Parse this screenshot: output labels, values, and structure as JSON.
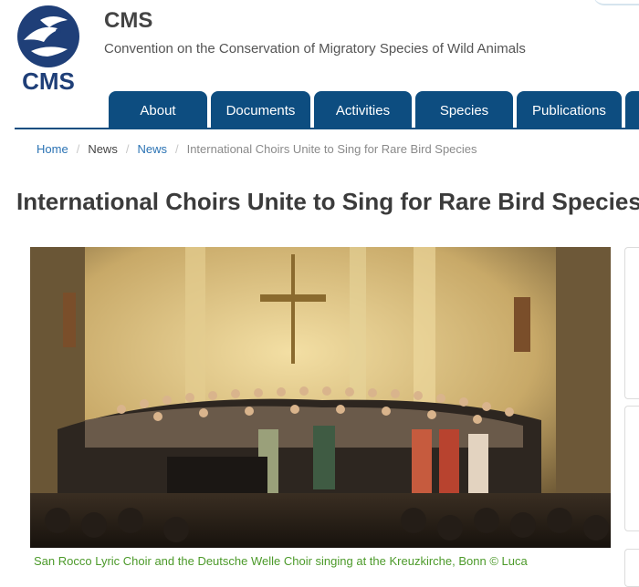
{
  "header": {
    "site_name": "CMS",
    "tagline": "Convention on the Conservation of Migratory Species of Wild Animals",
    "logo_text": "CMS"
  },
  "nav": {
    "items": [
      {
        "label": "About"
      },
      {
        "label": "Documents"
      },
      {
        "label": "Activities"
      },
      {
        "label": "Species"
      },
      {
        "label": "Publications"
      }
    ]
  },
  "breadcrumb": {
    "home": "Home",
    "section": "News",
    "subsection": "News",
    "current": "International Choirs Unite to Sing for Rare Bird Species"
  },
  "article": {
    "title": "International Choirs Unite to Sing for Rare Bird Species",
    "caption": "San Rocco Lyric Choir and the Deutsche Welle Choir singing at the Kreuzkirche, Bonn © Luca"
  },
  "colors": {
    "brand": "#0d4d80",
    "link": "#2b73b4",
    "caption": "#4c9a2a"
  }
}
